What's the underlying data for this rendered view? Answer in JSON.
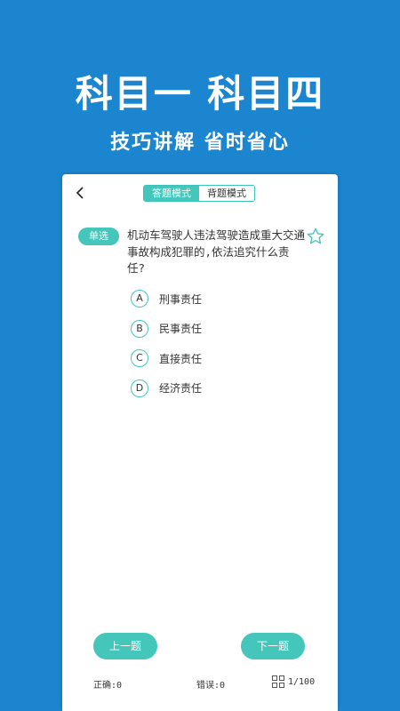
{
  "promo": {
    "headline": "科目一 科目四",
    "subline": "技巧讲解 省时省心"
  },
  "header": {
    "back_icon": "chevron-left-icon",
    "modes": [
      "答题模式",
      "背题模式"
    ],
    "active_mode": "答题模式"
  },
  "question": {
    "type_label": "单选",
    "text": "机动车驾驶人违法驾驶造成重大交通事故构成犯罪的,依法追究什么责任?",
    "favorite_icon": "star-outline-icon",
    "options": [
      {
        "letter": "A",
        "text": "刑事责任"
      },
      {
        "letter": "B",
        "text": "民事责任"
      },
      {
        "letter": "C",
        "text": "直接责任"
      },
      {
        "letter": "D",
        "text": "经济责任"
      }
    ]
  },
  "navigation": {
    "prev_label": "上一题",
    "next_label": "下一题"
  },
  "footer": {
    "correct": "正确:0",
    "wrong": "错误:0",
    "progress": "1/100",
    "grid_icon": "grid-icon"
  },
  "colors": {
    "background": "#1b86cf",
    "accent": "#45c6bb"
  }
}
